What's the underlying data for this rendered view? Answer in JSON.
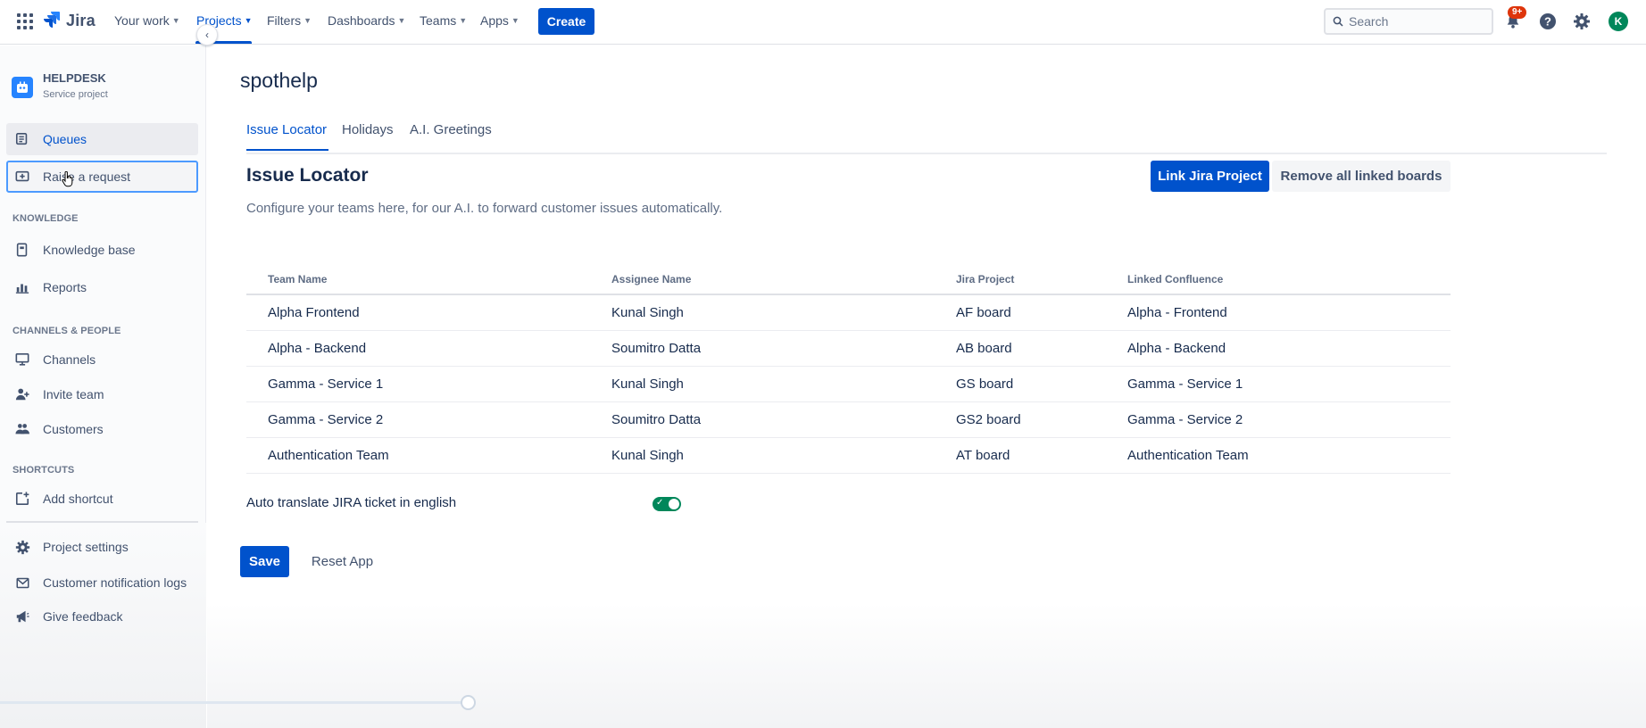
{
  "topnav": {
    "logo_text": "Jira",
    "items": [
      {
        "label": "Your work"
      },
      {
        "label": "Projects"
      },
      {
        "label": "Filters"
      },
      {
        "label": "Dashboards"
      },
      {
        "label": "Teams"
      },
      {
        "label": "Apps"
      }
    ],
    "create_label": "Create",
    "search_placeholder": "Search",
    "notification_badge": "9+",
    "avatar_initial": "K",
    "accent_color": "#0052cc"
  },
  "sidebar": {
    "project_name": "HELPDESK",
    "project_type": "Service project",
    "items_top": [
      {
        "label": "Queues",
        "icon": "queues-icon"
      },
      {
        "label": "Raise a request",
        "icon": "raise-request-icon"
      }
    ],
    "knowledge_heading": "KNOWLEDGE",
    "knowledge_items": [
      {
        "label": "Knowledge base",
        "icon": "knowledge-base-icon"
      },
      {
        "label": "Reports",
        "icon": "reports-icon"
      }
    ],
    "channels_heading": "CHANNELS & PEOPLE",
    "channels_items": [
      {
        "label": "Channels",
        "icon": "monitor-icon"
      },
      {
        "label": "Invite team",
        "icon": "invite-person-icon"
      },
      {
        "label": "Customers",
        "icon": "people-icon"
      }
    ],
    "shortcuts_heading": "SHORTCUTS",
    "shortcuts_items": [
      {
        "label": "Add shortcut",
        "icon": "add-shortcut-icon"
      }
    ],
    "bottom_items": [
      {
        "label": "Project settings",
        "icon": "gear-icon"
      },
      {
        "label": "Customer notification logs",
        "icon": "envelope-icon"
      },
      {
        "label": "Give feedback",
        "icon": "megaphone-icon"
      }
    ]
  },
  "main": {
    "page_title": "spothelp",
    "tabs": [
      {
        "label": "Issue Locator"
      },
      {
        "label": "Holidays"
      },
      {
        "label": "A.I. Greetings"
      }
    ],
    "section_title": "Issue Locator",
    "section_desc": "Configure your teams here, for our A.I. to forward customer issues automatically.",
    "link_button": "Link Jira Project",
    "remove_button": "Remove all linked boards",
    "table": {
      "headers": [
        "Team Name",
        "Assignee Name",
        "Jira Project",
        "Linked Confluence"
      ],
      "rows": [
        [
          "Alpha Frontend",
          "Kunal Singh",
          "AF board",
          "Alpha - Frontend"
        ],
        [
          "Alpha - Backend",
          "Soumitro Datta",
          "AB board",
          "Alpha - Backend"
        ],
        [
          "Gamma - Service 1",
          "Kunal Singh",
          "GS board",
          "Gamma - Service 1"
        ],
        [
          "Gamma - Service 2",
          "Soumitro Datta",
          "GS2 board",
          "Gamma - Service 2"
        ],
        [
          "Authentication Team",
          "Kunal Singh",
          "AT board",
          "Authentication Team"
        ]
      ]
    },
    "toggle_label": "Auto translate JIRA ticket in english",
    "toggle_on": true,
    "toggle_color": "#00875a",
    "save_button": "Save",
    "reset_button": "Reset App"
  }
}
